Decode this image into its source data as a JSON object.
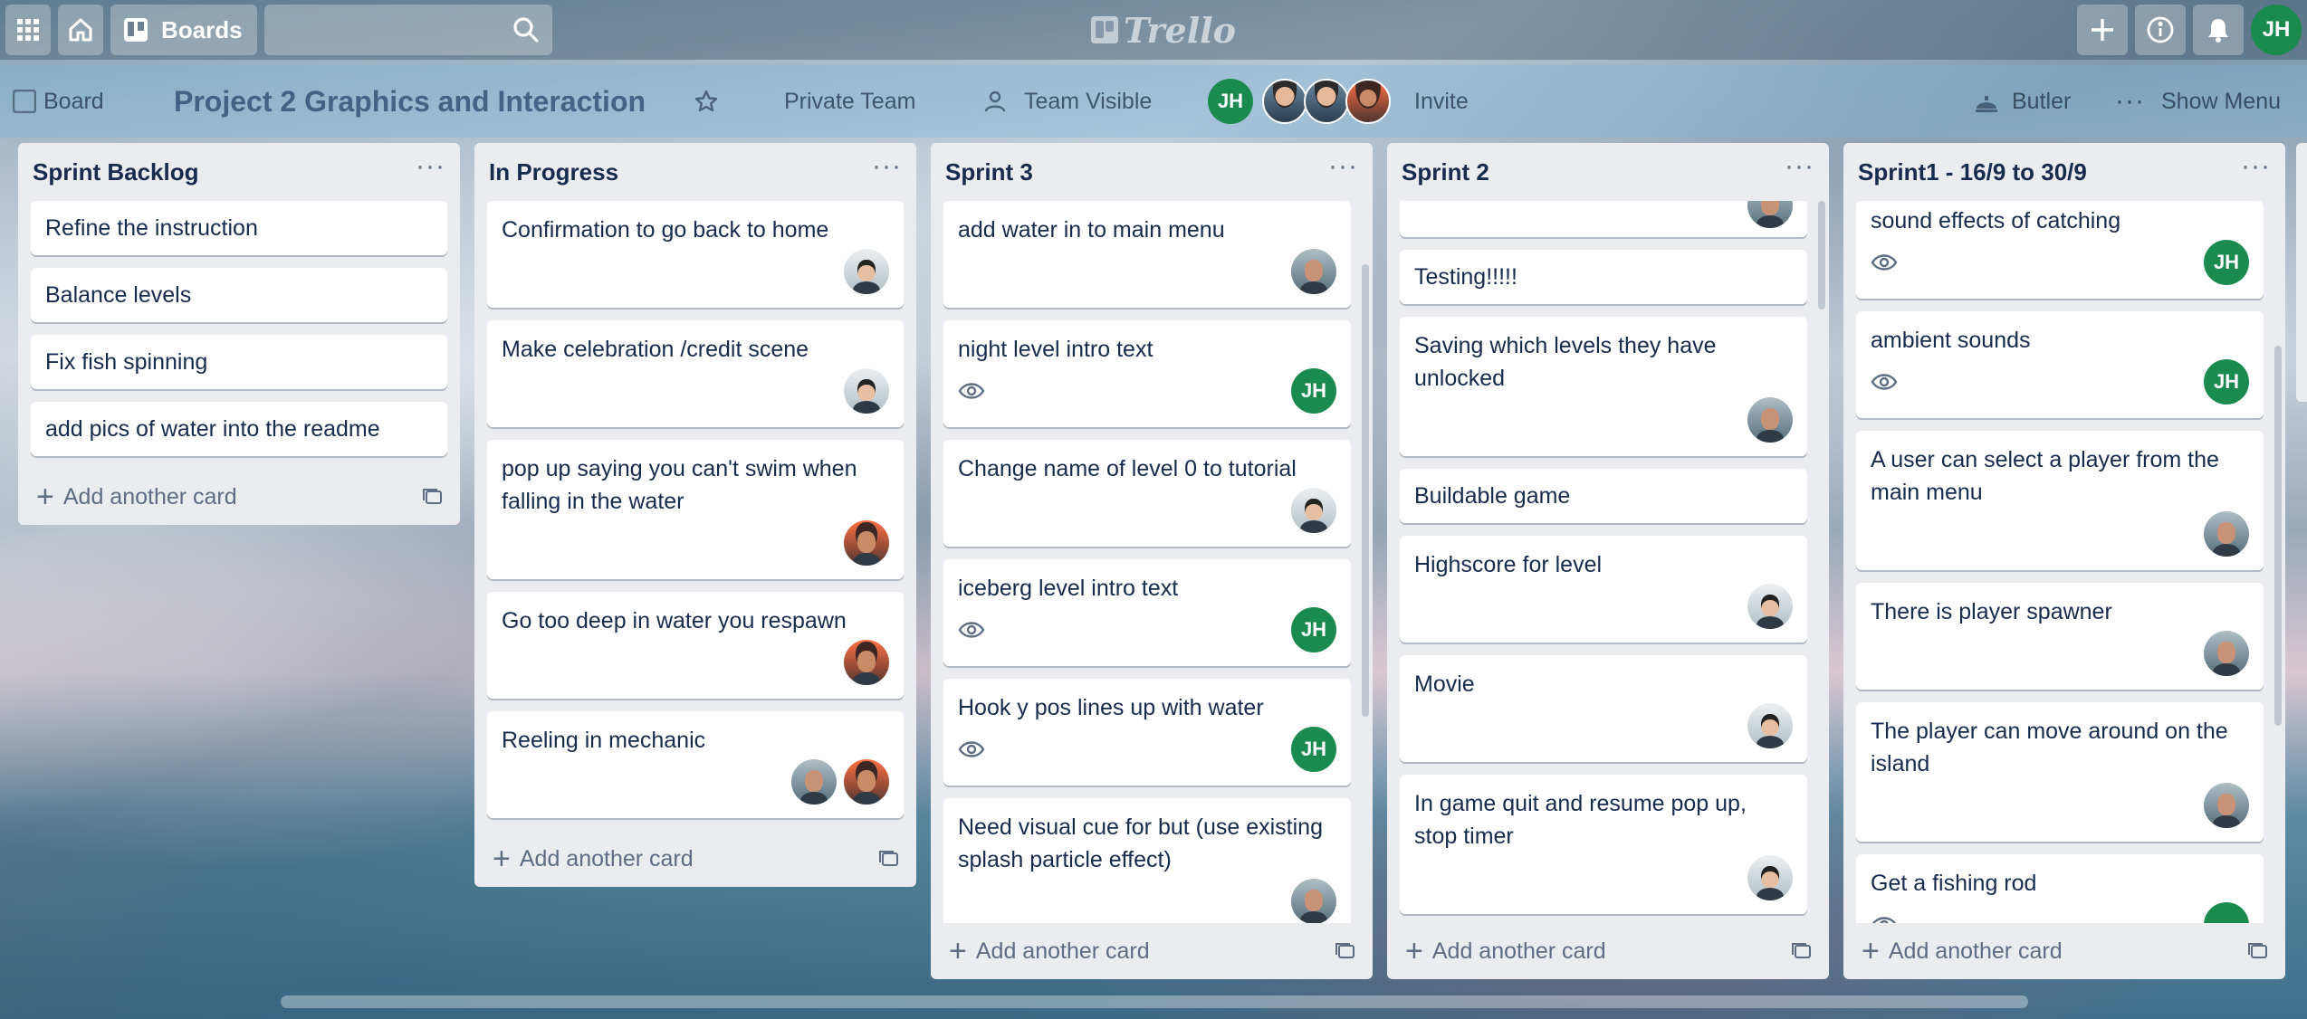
{
  "header": {
    "boards_label": "Boards",
    "logo_text": "Trello",
    "user_initials": "JH",
    "search_placeholder": ""
  },
  "board": {
    "breadcrumb": "Board",
    "title": "Project 2 Graphics and Interaction",
    "team": "Private Team",
    "visibility": "Team Visible",
    "invite": "Invite",
    "butler": "Butler",
    "show_menu": "Show Menu",
    "member_initials": "JH"
  },
  "lists": [
    {
      "title": "Sprint Backlog",
      "add_label": "Add another card",
      "cards": [
        {
          "text": "Refine the instruction"
        },
        {
          "text": "Balance levels"
        },
        {
          "text": "Fix fish spinning"
        },
        {
          "text": "add pics of water into the readme"
        }
      ]
    },
    {
      "title": "In Progress",
      "add_label": "Add another card",
      "cards": [
        {
          "text": "Confirmation to go back to home"
        },
        {
          "text": "Make celebration /credit scene"
        },
        {
          "text": "pop up saying you can't swim when falling in the water"
        },
        {
          "text": "Go too deep in water you respawn"
        },
        {
          "text": "Reeling in mechanic"
        }
      ]
    },
    {
      "title": "Sprint 3",
      "add_label": "Add another card",
      "cards": [
        {
          "text": "add water in to main menu"
        },
        {
          "text": "night level intro text",
          "member": "JH"
        },
        {
          "text": "Change name of level 0 to tutorial"
        },
        {
          "text": "iceberg level intro text",
          "member": "JH"
        },
        {
          "text": "Hook y pos lines up with water",
          "member": "JH"
        },
        {
          "text": "Need visual cue for but (use existing splash particle effect)"
        }
      ]
    },
    {
      "title": "Sprint 2",
      "add_label": "Add another card",
      "cards": [
        {
          "text": ""
        },
        {
          "text": "Testing!!!!!"
        },
        {
          "text": "Saving which levels they have unlocked"
        },
        {
          "text": "Buildable game"
        },
        {
          "text": "Highscore for level"
        },
        {
          "text": "Movie"
        },
        {
          "text": "In game quit and resume pop up, stop timer"
        }
      ]
    },
    {
      "title": "Sprint1 - 16/9 to 30/9",
      "add_label": "Add another card",
      "cards": [
        {
          "text": "sound effects of catching",
          "member": "JH"
        },
        {
          "text": "ambient sounds",
          "member": "JH"
        },
        {
          "text": "A user can select a player from the main menu"
        },
        {
          "text": "There is player spawner"
        },
        {
          "text": "The player can move around on the island"
        },
        {
          "text": "Get a fishing rod"
        }
      ]
    }
  ],
  "icons": [
    "apps-grid-icon",
    "home-icon",
    "boards-icon",
    "search-icon",
    "plus-icon",
    "info-icon",
    "bell-icon",
    "star-icon",
    "lock-icon",
    "people-icon",
    "butler-icon",
    "more-icon",
    "eye-icon",
    "template-icon",
    "add-icon"
  ],
  "colors": {
    "member_green": "#1a8a4e",
    "list_bg": "#ebecf0",
    "text": "#172b4d",
    "muted": "#5e6c84"
  }
}
